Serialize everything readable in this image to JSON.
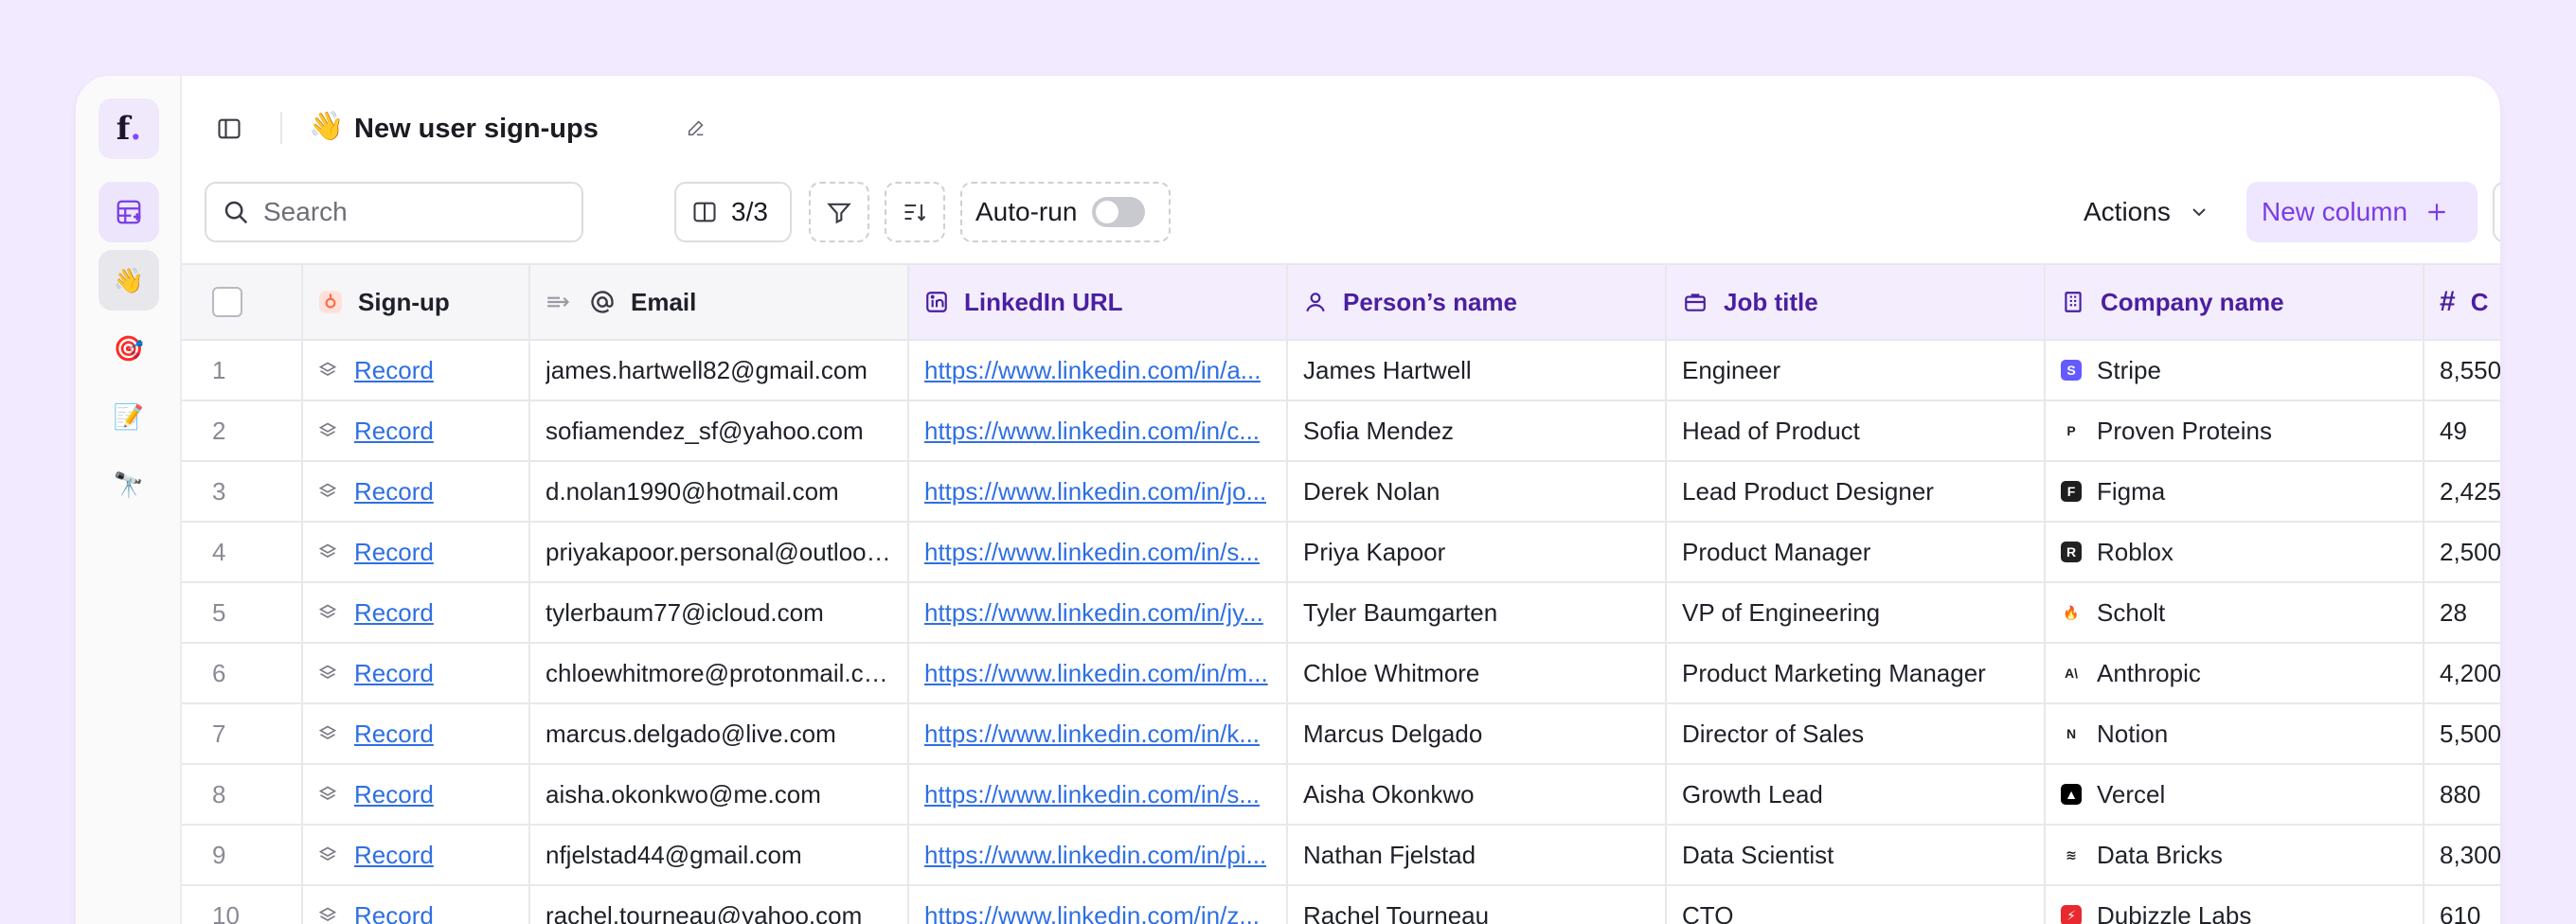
{
  "app": {
    "logo_text": "f",
    "logo_dot": "."
  },
  "rail": [
    {
      "name": "tables",
      "icon": "table-icon"
    },
    {
      "name": "new-user-signups",
      "icon": "waving-hand-icon"
    },
    {
      "name": "target",
      "icon": "target-icon"
    },
    {
      "name": "notes",
      "icon": "memo-icon"
    },
    {
      "name": "telescope",
      "icon": "telescope-icon"
    }
  ],
  "header": {
    "emoji": "👋",
    "title": "New user sign-ups"
  },
  "toolbar": {
    "search_placeholder": "Search",
    "columns_count": "3/3",
    "autorun_label": "Auto-run",
    "autorun_on": false,
    "actions_label": "Actions",
    "new_column_label": "New column"
  },
  "columns": {
    "signup": "Sign-up",
    "email": "Email",
    "linkedin": "LinkedIn URL",
    "name": "Person’s name",
    "job": "Job title",
    "company": "Company name",
    "number_partial": "C"
  },
  "rows": [
    {
      "idx": "1",
      "record": "Record",
      "email": "james.hartwell82@gmail.com",
      "linkedin": "https://www.linkedin.com/in/a...",
      "name": "James Hartwell",
      "job": "Engineer",
      "company": "Stripe",
      "logo": "#635bff",
      "logo_char": "S",
      "num": "8,550"
    },
    {
      "idx": "2",
      "record": "Record",
      "email": "sofiamendez_sf@yahoo.com",
      "linkedin": "https://www.linkedin.com/in/c...",
      "name": "Sofia Mendez",
      "job": "Head of Product",
      "company": "Proven Proteins",
      "logo": "#ffffff",
      "logo_char": "P",
      "num": "49"
    },
    {
      "idx": "3",
      "record": "Record",
      "email": "d.nolan1990@hotmail.com",
      "linkedin": "https://www.linkedin.com/in/jo...",
      "name": "Derek Nolan",
      "job": "Lead Product Designer",
      "company": "Figma",
      "logo": "#1e1e1e",
      "logo_char": "F",
      "num": "2,425"
    },
    {
      "idx": "4",
      "record": "Record",
      "email": "priyakapoor.personal@outlook...",
      "linkedin": "https://www.linkedin.com/in/s...",
      "name": "Priya Kapoor",
      "job": "Product Manager",
      "company": "Roblox",
      "logo": "#222222",
      "logo_char": "R",
      "num": "2,500"
    },
    {
      "idx": "5",
      "record": "Record",
      "email": "tylerbaum77@icloud.com",
      "linkedin": "https://www.linkedin.com/in/jy...",
      "name": "Tyler Baumgarten",
      "job": "VP of Engineering",
      "company": "Scholt",
      "logo": "#ffffff",
      "logo_char": "🔥",
      "num": "28"
    },
    {
      "idx": "6",
      "record": "Record",
      "email": "chloewhitmore@protonmail.com",
      "linkedin": "https://www.linkedin.com/in/m...",
      "name": "Chloe Whitmore",
      "job": "Product Marketing Manager",
      "company": "Anthropic",
      "logo": "#ffffff",
      "logo_char": "A\\",
      "num": "4,200"
    },
    {
      "idx": "7",
      "record": "Record",
      "email": "marcus.delgado@live.com",
      "linkedin": "https://www.linkedin.com/in/k...",
      "name": "Marcus Delgado",
      "job": "Director of Sales",
      "company": "Notion",
      "logo": "#ffffff",
      "logo_char": "N",
      "num": "5,500"
    },
    {
      "idx": "8",
      "record": "Record",
      "email": "aisha.okonkwo@me.com",
      "linkedin": "https://www.linkedin.com/in/s...",
      "name": "Aisha Okonkwo",
      "job": "Growth Lead",
      "company": "Vercel",
      "logo": "#000000",
      "logo_char": "▲",
      "num": "880"
    },
    {
      "idx": "9",
      "record": "Record",
      "email": "nfjelstad44@gmail.com",
      "linkedin": "https://www.linkedin.com/in/pi...",
      "name": "Nathan Fjelstad",
      "job": "Data Scientist",
      "company": "Data Bricks",
      "logo": "#ffffff",
      "logo_char": "≋",
      "num": "8,300"
    },
    {
      "idx": "10",
      "record": "Record",
      "email": "rachel.tourneau@yahoo.com",
      "linkedin": "https://www.linkedin.com/in/z...",
      "name": "Rachel Tourneau",
      "job": "CTO",
      "company": "Dubizzle Labs",
      "logo": "#e8292e",
      "logo_char": "⚡",
      "num": "610"
    }
  ]
}
